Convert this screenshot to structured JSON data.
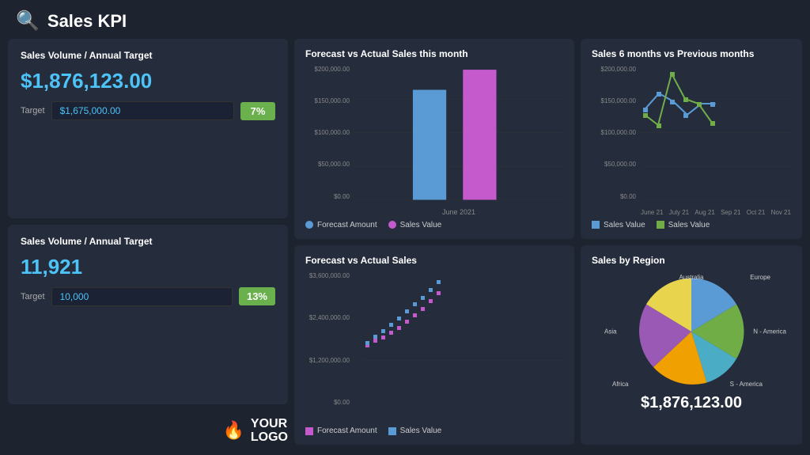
{
  "header": {
    "icon": "🔍",
    "title": "Sales KPI"
  },
  "card1": {
    "title": "Forecast vs Actual Sales this month",
    "yLabels": [
      "$200,000.00",
      "$150,000.00",
      "$100,000.00",
      "$50,000.00",
      "$0.00"
    ],
    "xLabel": "June 2021",
    "bar1Color": "#5b9bd5",
    "bar2Color": "#c55acc",
    "bar1Height": 65,
    "bar2Height": 80,
    "legend": [
      {
        "label": "Forecast Amount",
        "color": "#5b9bd5",
        "type": "dot"
      },
      {
        "label": "Sales Value",
        "color": "#c55acc",
        "type": "dot"
      }
    ]
  },
  "card2": {
    "title": "Sales 6 months vs Previous months",
    "yLabels": [
      "$200,000.00",
      "$150,000.00",
      "$100,000.00",
      "$50,000.00",
      "$0.00"
    ],
    "xLabels": [
      "June 21",
      "July 21",
      "Aug 21",
      "Sep 21",
      "Oct 21",
      "Nov 21"
    ],
    "legend": [
      {
        "label": "Sales Value",
        "color": "#5b9bd5",
        "type": "sq"
      },
      {
        "label": "Sales Value",
        "color": "#70ad47",
        "type": "sq"
      }
    ]
  },
  "card3": {
    "title": "Forecast vs Actual Sales",
    "yLabels": [
      "$3,600,000.00",
      "$2,400,000.00",
      "$1,200,000.00",
      "$0.00"
    ],
    "legend": [
      {
        "label": "Forecast Amount",
        "color": "#c55acc",
        "type": "sq"
      },
      {
        "label": "Sales Value",
        "color": "#5b9bd5",
        "type": "sq"
      }
    ]
  },
  "card4": {
    "title": "Sales by Region",
    "total": "$1,876,123.00",
    "regions": [
      {
        "label": "Europe",
        "color": "#5b9bd5",
        "value": 20
      },
      {
        "label": "N - America",
        "color": "#70ad47",
        "value": 20
      },
      {
        "label": "S - America",
        "color": "#4bacc6",
        "value": 15
      },
      {
        "label": "Africa",
        "color": "#f0a000",
        "value": 15
      },
      {
        "label": "Asia",
        "color": "#9b59b6",
        "value": 15
      },
      {
        "label": "Australia",
        "color": "#e8d44d",
        "value": 15
      }
    ]
  },
  "kpi1": {
    "title": "Sales Volume / Annual Target",
    "value": "$1,876,123.00",
    "targetLabel": "Target",
    "targetValue": "$1,675,000.00",
    "badge": "7%"
  },
  "kpi2": {
    "title": "Sales Volume / Annual Target",
    "value": "11,921",
    "targetLabel": "Target",
    "targetValue": "10,000",
    "badge": "13%"
  },
  "logo": {
    "icon": "🔥",
    "line1": "YOUR",
    "line2": "LOGO"
  }
}
